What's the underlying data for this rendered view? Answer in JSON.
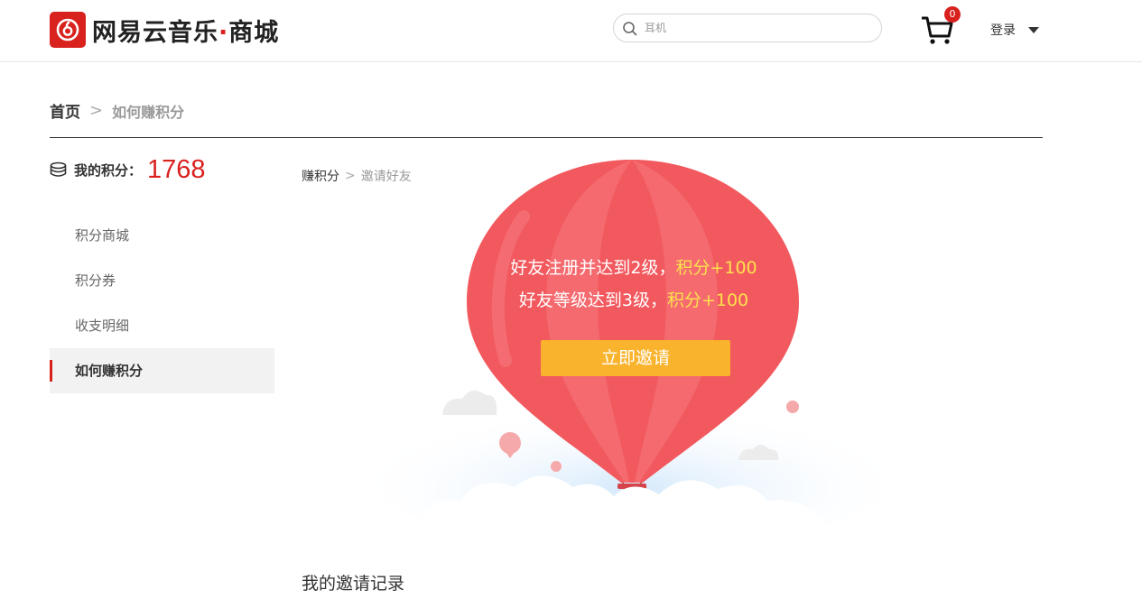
{
  "header": {
    "logo_text": "网易云音乐",
    "logo_dot": "·",
    "logo_suffix": "商城",
    "search_placeholder": "耳机",
    "cart_count": "0",
    "login_label": "登录",
    "brand_color": "#d9211e"
  },
  "breadcrumb": {
    "home": "首页",
    "separator": ">",
    "current": "如何赚积分"
  },
  "points": {
    "label": "我的积分：",
    "value": "1768"
  },
  "side_menu": [
    {
      "label": "积分商城"
    },
    {
      "label": "积分券"
    },
    {
      "label": "收支明细"
    },
    {
      "label": "如何赚积分",
      "active": true
    }
  ],
  "sub_breadcrumb": {
    "parent": "赚积分",
    "separator": ">",
    "current": "邀请好友"
  },
  "invite": {
    "line1_text": "好友注册并达到2级，",
    "line1_reward": "积分+100",
    "line2_text": "好友等级达到3级，",
    "line2_reward": "积分+100",
    "button_label": "立即邀请",
    "button_color": "#f9b32d",
    "balloon_color": "#f2595e",
    "highlight_color": "#ffe14d"
  },
  "records": {
    "title": "我的邀请记录"
  }
}
